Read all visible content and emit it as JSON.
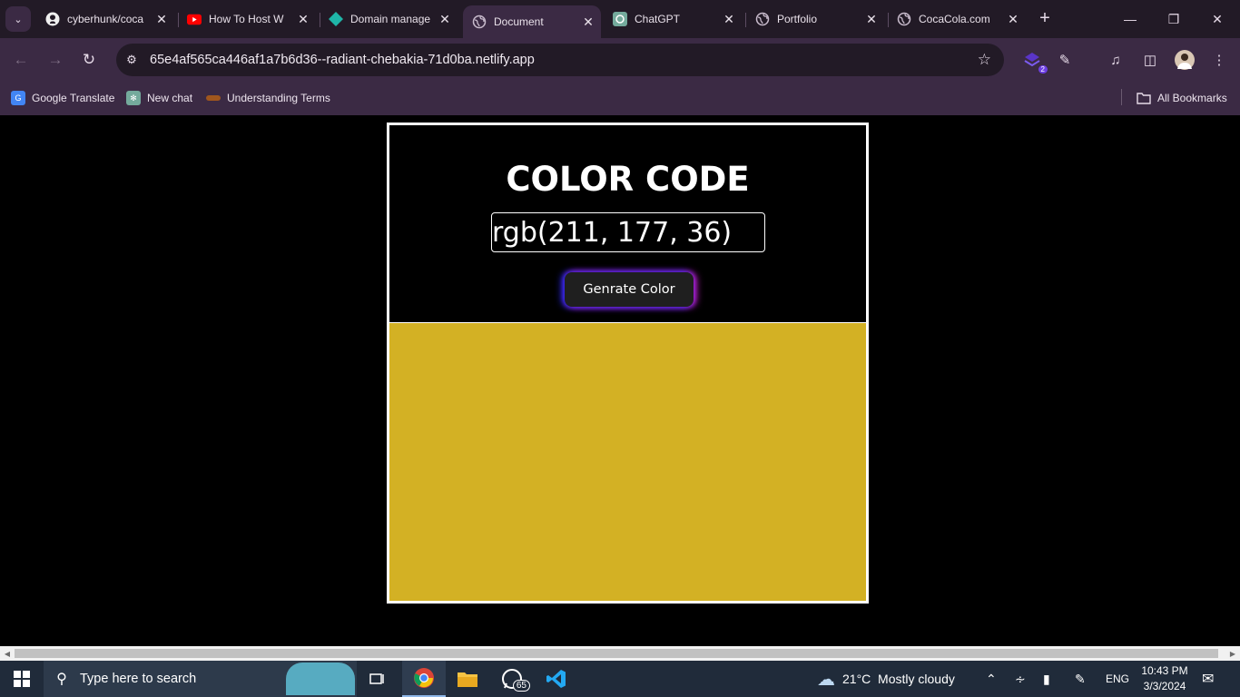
{
  "browser": {
    "tabs": [
      {
        "title": "cyberhunk/coca",
        "icon": "github-icon"
      },
      {
        "title": "How To Host W",
        "icon": "youtube-icon"
      },
      {
        "title": "Domain manage",
        "icon": "netlify-icon"
      },
      {
        "title": "Document",
        "icon": "globe-icon",
        "active": true
      },
      {
        "title": "ChatGPT",
        "icon": "chatgpt-icon"
      },
      {
        "title": "Portfolio",
        "icon": "globe-icon"
      },
      {
        "title": "CocaCola.com",
        "icon": "globe-icon"
      }
    ],
    "url": "65e4af565ca446af1a7b6d36--radiant-chebakia-71d0ba.netlify.app",
    "extension_badge": "2",
    "bookmarks": [
      {
        "label": "Google Translate",
        "icon": "google-translate-icon"
      },
      {
        "label": "New chat",
        "icon": "chatgpt-icon"
      },
      {
        "label": "Understanding Terms",
        "icon": "bookmark-favicon"
      }
    ],
    "all_bookmarks_label": "All Bookmarks"
  },
  "page": {
    "heading": "COLOR CODE",
    "color_value": "rgb(211, 177, 36)",
    "button_label": "Genrate Color",
    "swatch_color": "#d3b124"
  },
  "taskbar": {
    "search_placeholder": "Type here to search",
    "whatsapp_badge": "65",
    "weather": "21°C  Mostly cloudy",
    "language": "ENG",
    "time": "10:43 PM",
    "date": "3/3/2024"
  }
}
